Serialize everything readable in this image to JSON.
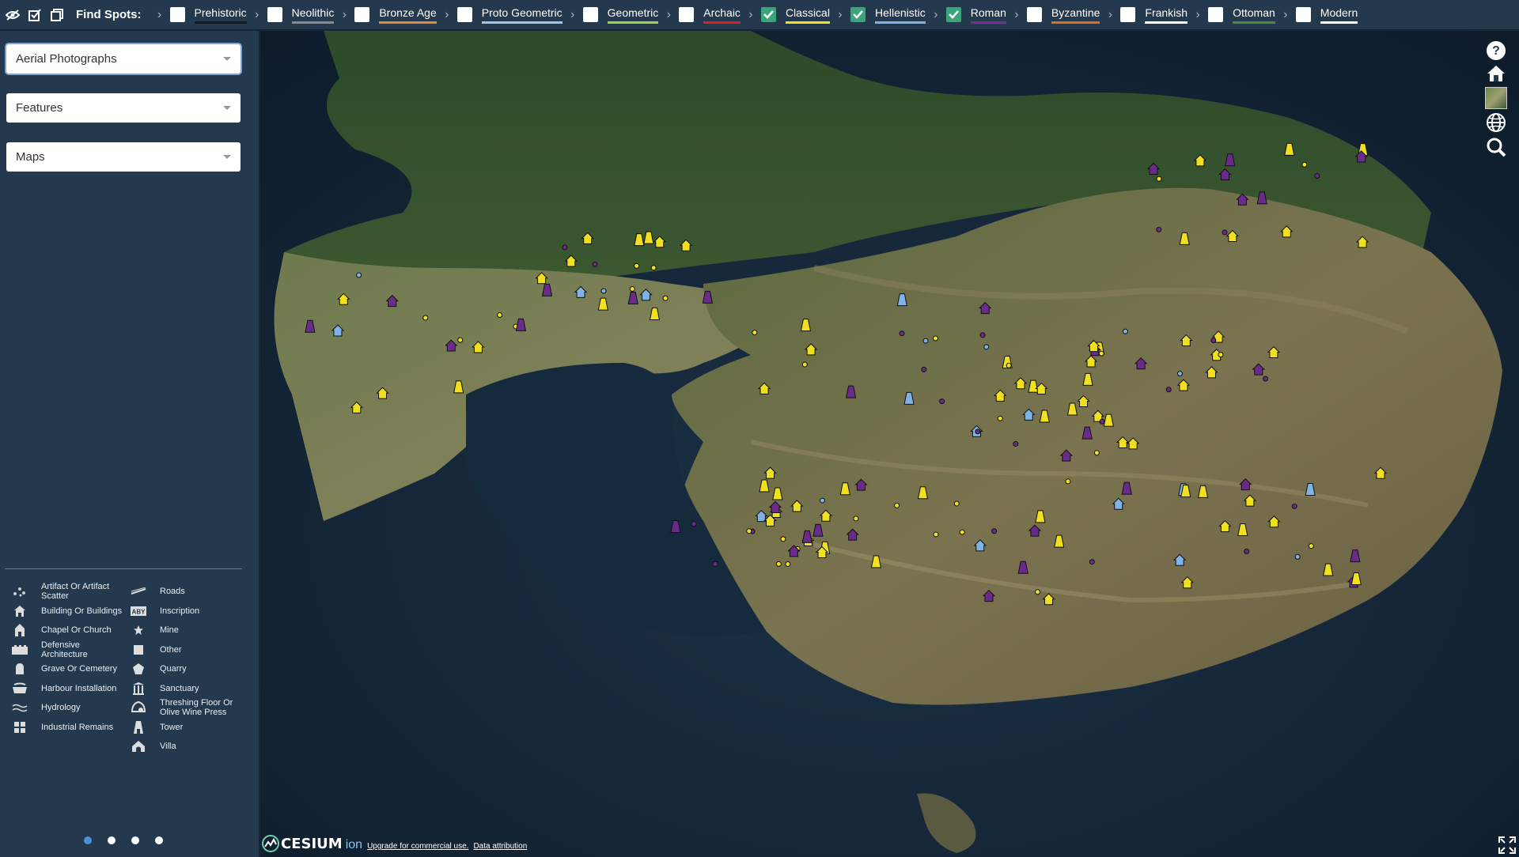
{
  "topbar": {
    "title": "Find Spots:",
    "periods": [
      {
        "label": "Prehistoric",
        "checked": false,
        "color": "#1a1a1a"
      },
      {
        "label": "Neolithic",
        "checked": false,
        "color": "#8a8a8a"
      },
      {
        "label": "Bronze Age",
        "checked": false,
        "color": "#e08a3a"
      },
      {
        "label": "Proto Geometric",
        "checked": false,
        "color": "#a0c8e0"
      },
      {
        "label": "Geometric",
        "checked": false,
        "color": "#9bd44a"
      },
      {
        "label": "Archaic",
        "checked": false,
        "color": "#e02020"
      },
      {
        "label": "Classical",
        "checked": true,
        "color": "#f0e020"
      },
      {
        "label": "Hellenistic",
        "checked": true,
        "color": "#7fb2e5"
      },
      {
        "label": "Roman",
        "checked": true,
        "color": "#7a2a9a"
      },
      {
        "label": "Byzantine",
        "checked": false,
        "color": "#e07020"
      },
      {
        "label": "Frankish",
        "checked": false,
        "color": "#ffffff"
      },
      {
        "label": "Ottoman",
        "checked": false,
        "color": "#4a8a3a"
      },
      {
        "label": "Modern",
        "checked": false,
        "color": "#ffffff"
      }
    ]
  },
  "sidebar": {
    "selects": [
      {
        "label": "Aerial Photographs",
        "active": true
      },
      {
        "label": "Features",
        "active": false
      },
      {
        "label": "Maps",
        "active": false
      }
    ],
    "legend_left": [
      {
        "label": "Artifact Or Artifact Scatter",
        "icon": "scatter-icon"
      },
      {
        "label": "Building Or Buildings",
        "icon": "building-icon"
      },
      {
        "label": "Chapel Or Church",
        "icon": "chapel-icon"
      },
      {
        "label": "Defensive Architecture",
        "icon": "defensive-icon"
      },
      {
        "label": "Grave Or Cemetery",
        "icon": "grave-icon"
      },
      {
        "label": "Harbour Installation",
        "icon": "harbour-icon"
      },
      {
        "label": "Hydrology",
        "icon": "hydrology-icon"
      },
      {
        "label": "Industrial Remains",
        "icon": "industrial-icon"
      }
    ],
    "legend_right": [
      {
        "label": "Roads",
        "icon": "roads-icon"
      },
      {
        "label": "Inscription",
        "icon": "inscription-icon"
      },
      {
        "label": "Mine",
        "icon": "mine-icon"
      },
      {
        "label": "Other",
        "icon": "other-icon"
      },
      {
        "label": "Quarry",
        "icon": "quarry-icon"
      },
      {
        "label": "Sanctuary",
        "icon": "sanctuary-icon"
      },
      {
        "label": "Threshing Floor Or Olive Wine Press",
        "icon": "threshing-icon"
      },
      {
        "label": "Tower",
        "icon": "tower-icon"
      },
      {
        "label": "Villa",
        "icon": "villa-icon"
      }
    ],
    "pager_count": 4,
    "pager_active": 0
  },
  "map": {
    "attribution": {
      "logo": "CESIUM",
      "ion": "ion",
      "upgrade": "Upgrade for commercial use.",
      "data": "Data attribution"
    },
    "marker_colors": {
      "classical": "#f0e020",
      "hellenistic": "#7fb2e5",
      "roman": "#6a2a8a"
    },
    "controls": [
      "help-icon",
      "home-icon",
      "basemap-picker-icon",
      "globe-icon",
      "search-icon"
    ]
  }
}
